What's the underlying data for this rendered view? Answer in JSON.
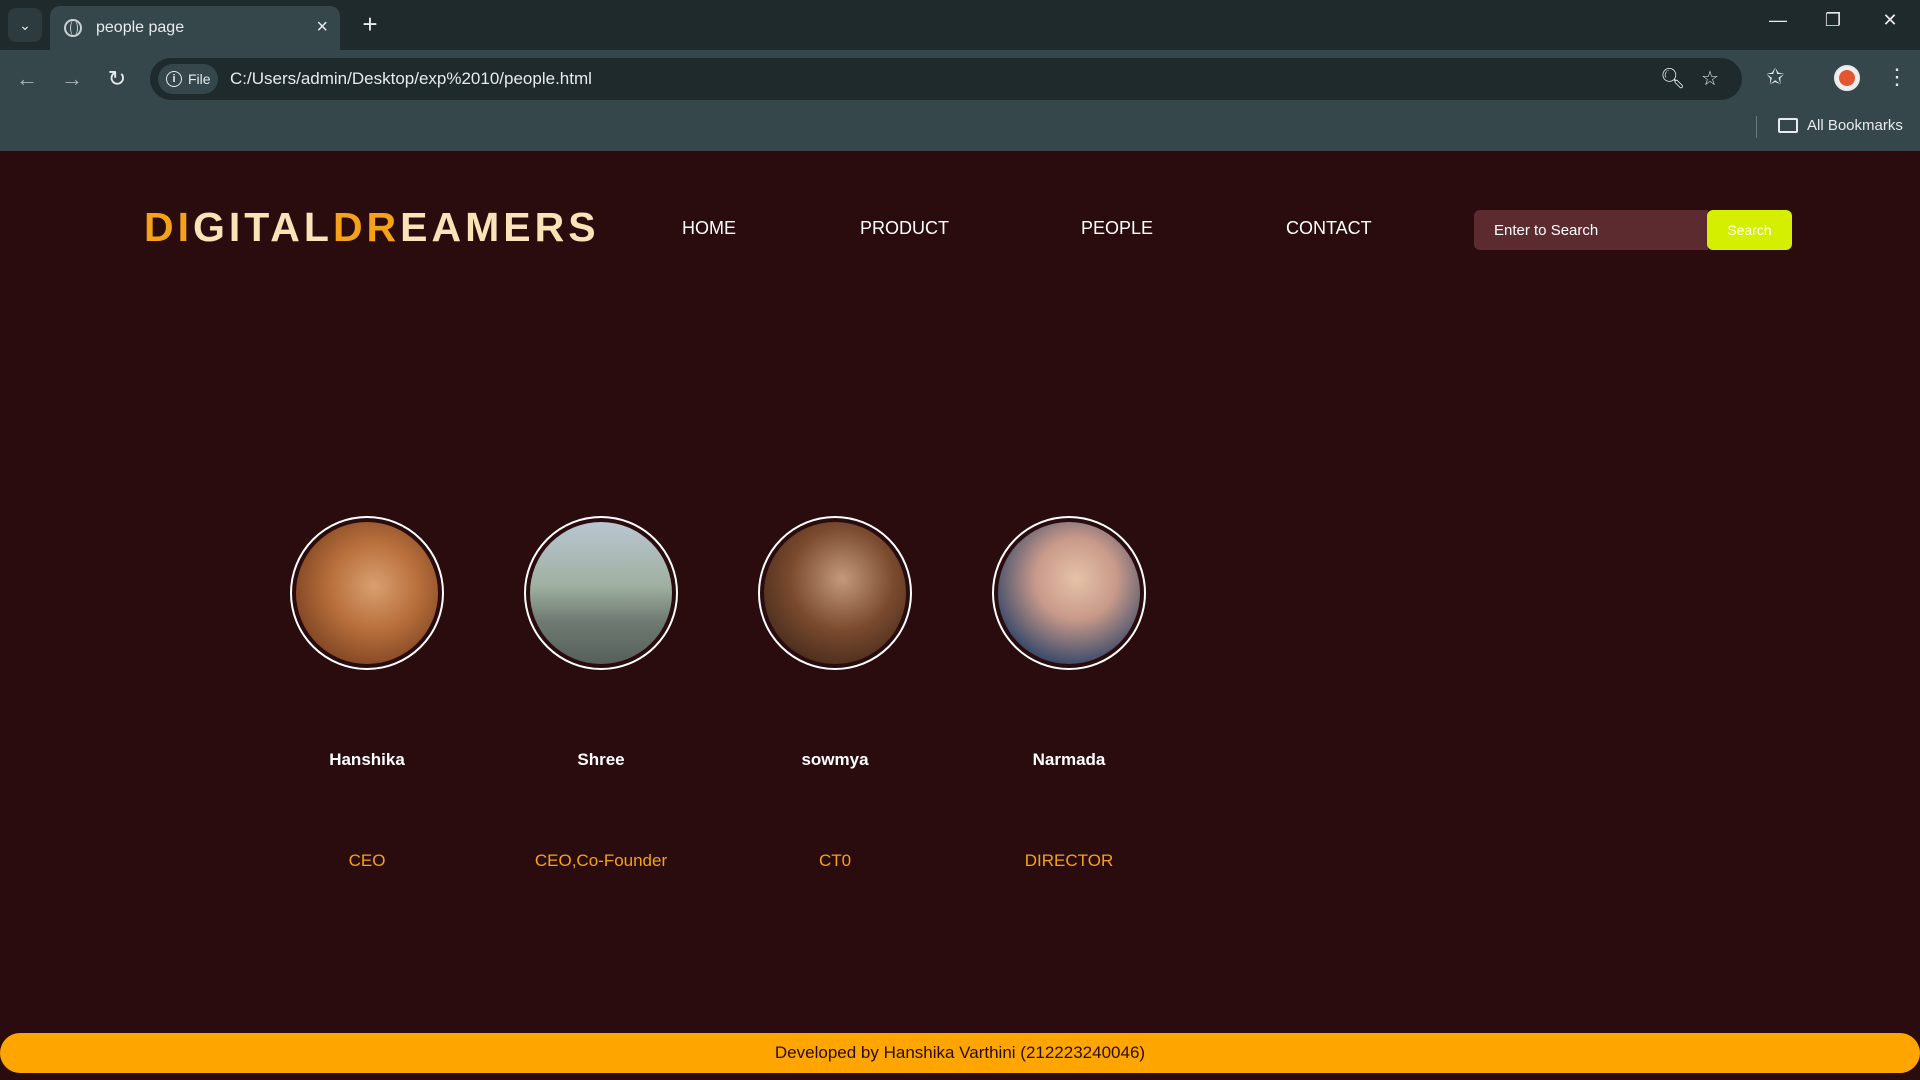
{
  "browser": {
    "tab_title": "people page",
    "url_chip": "File",
    "url": "C:/Users/admin/Desktop/exp%2010/people.html",
    "bookmarks_label": "All Bookmarks"
  },
  "site": {
    "logo_parts": [
      "DI",
      "GITAL",
      "DR",
      "EAMERS"
    ],
    "nav": [
      "HOME",
      "PRODUCT",
      "PEOPLE",
      "CONTACT"
    ],
    "search": {
      "placeholder": "Enter to Search",
      "button": "Search"
    }
  },
  "people": [
    {
      "name": "Hanshika",
      "role": "CEO"
    },
    {
      "name": "Shree",
      "role": "CEO,Co-Founder"
    },
    {
      "name": "sowmya",
      "role": "CT0"
    },
    {
      "name": "Narmada",
      "role": "DIRECTOR"
    }
  ],
  "footer": {
    "text": "Developed by Hanshika Varthini (212223240046)"
  },
  "colors": {
    "page_bg": "#2a0c0e",
    "accent": "#f5a218",
    "search_button": "#d4f000",
    "footer_bg": "#ffa500"
  }
}
